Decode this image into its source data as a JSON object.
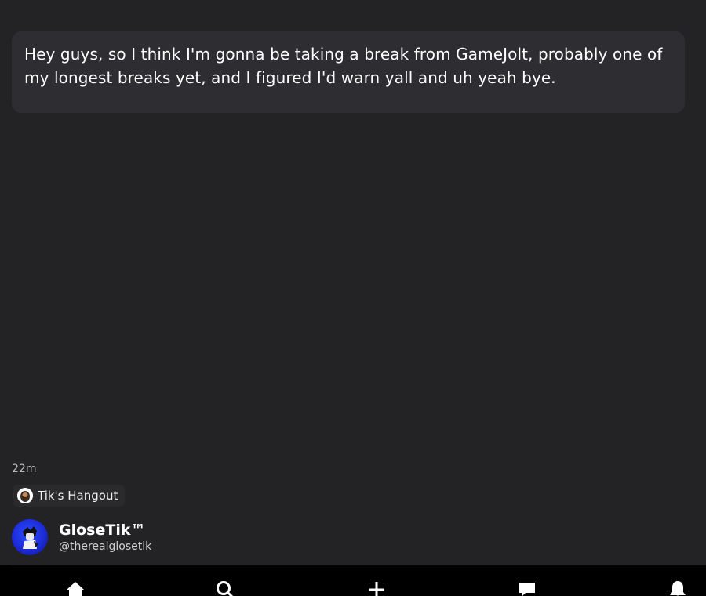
{
  "post": {
    "text": "Hey guys, so I think I'm gonna be taking a break from GameJolt, probably one of my longest breaks yet, and I figured I'd warn yall and uh yeah bye.",
    "timestamp": "22m"
  },
  "community": {
    "name": "Tik's Hangout"
  },
  "author": {
    "name": "GloseTik™",
    "handle": "@therealglosetik"
  },
  "nav": {
    "items": [
      {
        "icon": "home-icon",
        "active": true
      },
      {
        "icon": "search-icon",
        "active": false
      },
      {
        "icon": "add-icon",
        "active": false
      },
      {
        "icon": "chat-icon",
        "active": false
      },
      {
        "icon": "bell-icon",
        "active": false
      }
    ]
  },
  "colors": {
    "background": "#232225",
    "card": "#2e2d31",
    "nav_bar": "#000000",
    "avatar_blue": "#1c2bd6"
  }
}
